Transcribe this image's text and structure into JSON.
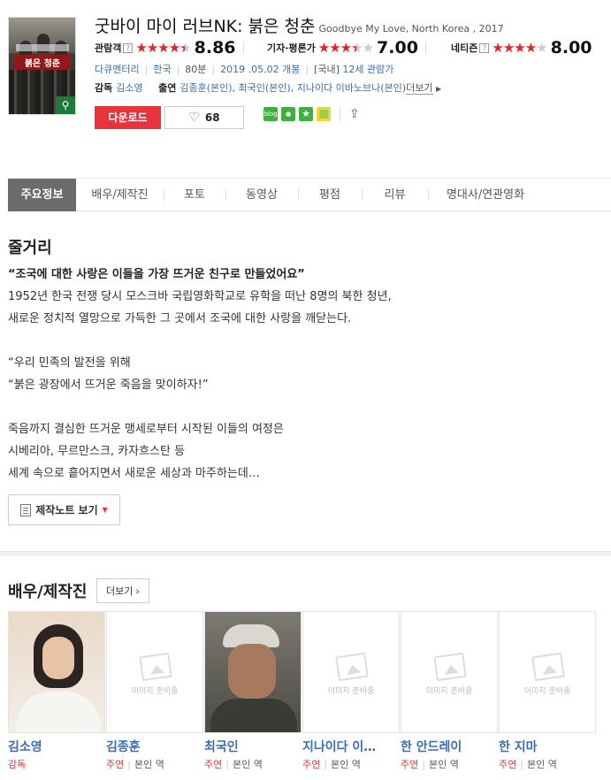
{
  "movie": {
    "title": "굿바이 마이 러브NK: 붉은 청춘",
    "original_title": "Goodbye My Love, North Korea , 2017",
    "poster_title": "붉은 청춘"
  },
  "ratings": [
    {
      "label": "관람객",
      "stars": 4.5,
      "score": "8.86",
      "has_help": true
    },
    {
      "label": "기자·평론가",
      "stars": 3.5,
      "score": "7.00",
      "has_help": false
    },
    {
      "label": "네티즌",
      "stars": 4.0,
      "score": "8.00",
      "has_help": true
    }
  ],
  "meta": {
    "genre": "다큐멘터리",
    "country": "한국",
    "runtime": "80분",
    "release": "2019 .05.02 개봉",
    "rating_prefix": "[국내]",
    "rating": "12세 관람가"
  },
  "credits": {
    "director_label": "감독",
    "director": "김소영",
    "cast_label": "출연",
    "cast": "김종훈(본인), 최국인(본인), 지나이다 이바노브나(본인)",
    "more": "더보기"
  },
  "actions": {
    "download": "다운로드",
    "likes": "68",
    "share_blog": "blog"
  },
  "tabs": [
    "주요정보",
    "배우/제작진",
    "포토",
    "동영상",
    "평점",
    "리뷰",
    "명대사/연관영화"
  ],
  "synopsis": {
    "heading": "줄거리",
    "quote": "“조국에 대한 사랑은 이들을 가장 뜨거운 친구로 만들었어요”",
    "lines": [
      "1952년 한국 전쟁 당시 모스크바 국립영화학교로 유학을 떠난 8명의 북한 청년,",
      " 새로운 정치적 열망으로 가득한 그 곳에서 조국에 대한 사랑을 깨닫는다.",
      "",
      " “우리 민족의 발전을 위해",
      " “붉은 광장에서 뜨거운 죽음을 맞이하자!”",
      "",
      " 죽음까지 결심한 뜨거운 맹세로부터 시작된 이들의 여정은",
      " 시베리아, 무르만스크, 카자흐스탄 등",
      " 세계 속으로 흩어지면서 새로운 세상과 마주하는데…"
    ],
    "note_button": "제작노트 보기"
  },
  "cast_section": {
    "heading": "배우/제작진",
    "more": "더보기",
    "no_image": "이미지 준비중",
    "members": [
      {
        "name": "김소영",
        "role": "감독",
        "part": "",
        "photo": "woman"
      },
      {
        "name": "김종훈",
        "role": "주연",
        "part": "본인 역",
        "photo": "none"
      },
      {
        "name": "최국인",
        "role": "주연",
        "part": "본인 역",
        "photo": "man"
      },
      {
        "name": "지나이다 이…",
        "role": "주연",
        "part": "본인 역",
        "photo": "none"
      },
      {
        "name": "한 안드레이",
        "role": "주연",
        "part": "본인 역",
        "photo": "none"
      },
      {
        "name": "한 지마",
        "role": "주연",
        "part": "본인 역",
        "photo": "none"
      }
    ]
  }
}
